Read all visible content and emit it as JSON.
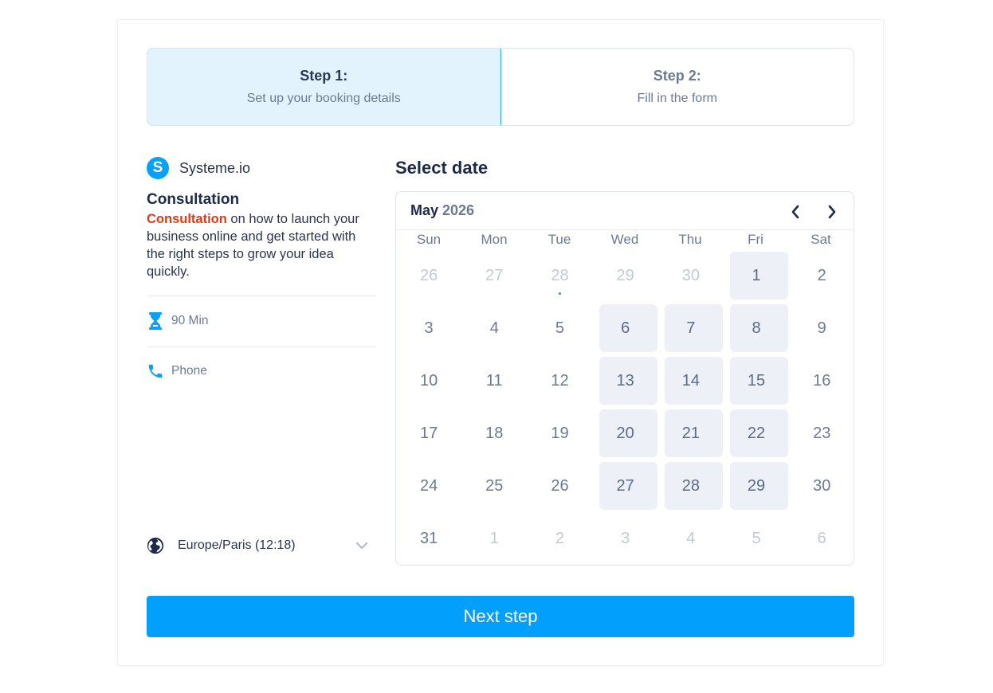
{
  "steps": [
    {
      "title": "Step 1:",
      "subtitle": "Set up your booking details",
      "active": true
    },
    {
      "title": "Step 2:",
      "subtitle": "Fill in the form",
      "active": false
    }
  ],
  "brand": {
    "logo_letter": "S",
    "name": "Systeme.io"
  },
  "event": {
    "title": "Consultation",
    "description_highlight": "Consultation",
    "description_rest": " on how to launch your business online and get started with the right steps to grow your idea quickly.",
    "duration": "90 Min",
    "location": "Phone"
  },
  "timezone": {
    "label": "Europe/Paris (12:18)"
  },
  "calendar": {
    "heading": "Select date",
    "month": "May",
    "year": "2026",
    "weekdays": [
      "Sun",
      "Mon",
      "Tue",
      "Wed",
      "Thu",
      "Fri",
      "Sat"
    ],
    "weeks": [
      [
        {
          "n": "26",
          "s": "muted"
        },
        {
          "n": "27",
          "s": "muted"
        },
        {
          "n": "28",
          "s": "muted",
          "today": true
        },
        {
          "n": "29",
          "s": "muted"
        },
        {
          "n": "30",
          "s": "muted"
        },
        {
          "n": "1",
          "s": "avail"
        },
        {
          "n": "2",
          "s": "normal"
        }
      ],
      [
        {
          "n": "3",
          "s": "normal"
        },
        {
          "n": "4",
          "s": "normal"
        },
        {
          "n": "5",
          "s": "normal"
        },
        {
          "n": "6",
          "s": "avail"
        },
        {
          "n": "7",
          "s": "avail"
        },
        {
          "n": "8",
          "s": "avail"
        },
        {
          "n": "9",
          "s": "normal"
        }
      ],
      [
        {
          "n": "10",
          "s": "normal"
        },
        {
          "n": "11",
          "s": "normal"
        },
        {
          "n": "12",
          "s": "normal"
        },
        {
          "n": "13",
          "s": "avail"
        },
        {
          "n": "14",
          "s": "avail"
        },
        {
          "n": "15",
          "s": "avail"
        },
        {
          "n": "16",
          "s": "normal"
        }
      ],
      [
        {
          "n": "17",
          "s": "normal"
        },
        {
          "n": "18",
          "s": "normal"
        },
        {
          "n": "19",
          "s": "normal"
        },
        {
          "n": "20",
          "s": "avail"
        },
        {
          "n": "21",
          "s": "avail"
        },
        {
          "n": "22",
          "s": "avail"
        },
        {
          "n": "23",
          "s": "normal"
        }
      ],
      [
        {
          "n": "24",
          "s": "normal"
        },
        {
          "n": "25",
          "s": "normal"
        },
        {
          "n": "26",
          "s": "normal"
        },
        {
          "n": "27",
          "s": "avail"
        },
        {
          "n": "28",
          "s": "avail"
        },
        {
          "n": "29",
          "s": "avail"
        },
        {
          "n": "30",
          "s": "normal"
        }
      ],
      [
        {
          "n": "31",
          "s": "normal"
        },
        {
          "n": "1",
          "s": "muted"
        },
        {
          "n": "2",
          "s": "muted"
        },
        {
          "n": "3",
          "s": "muted"
        },
        {
          "n": "4",
          "s": "muted"
        },
        {
          "n": "5",
          "s": "muted"
        },
        {
          "n": "6",
          "s": "muted"
        }
      ]
    ]
  },
  "next_button": {
    "label": "Next step"
  },
  "colors": {
    "accent": "#029ffc",
    "highlight": "#e23a14",
    "active_step_bg": "#e3f3fd"
  },
  "icons": {
    "duration": "hourglass-icon",
    "location": "phone-icon",
    "timezone": "globe-icon",
    "timezone_toggle": "chevron-down-icon",
    "prev": "chevron-left-icon",
    "next": "chevron-right-icon"
  }
}
